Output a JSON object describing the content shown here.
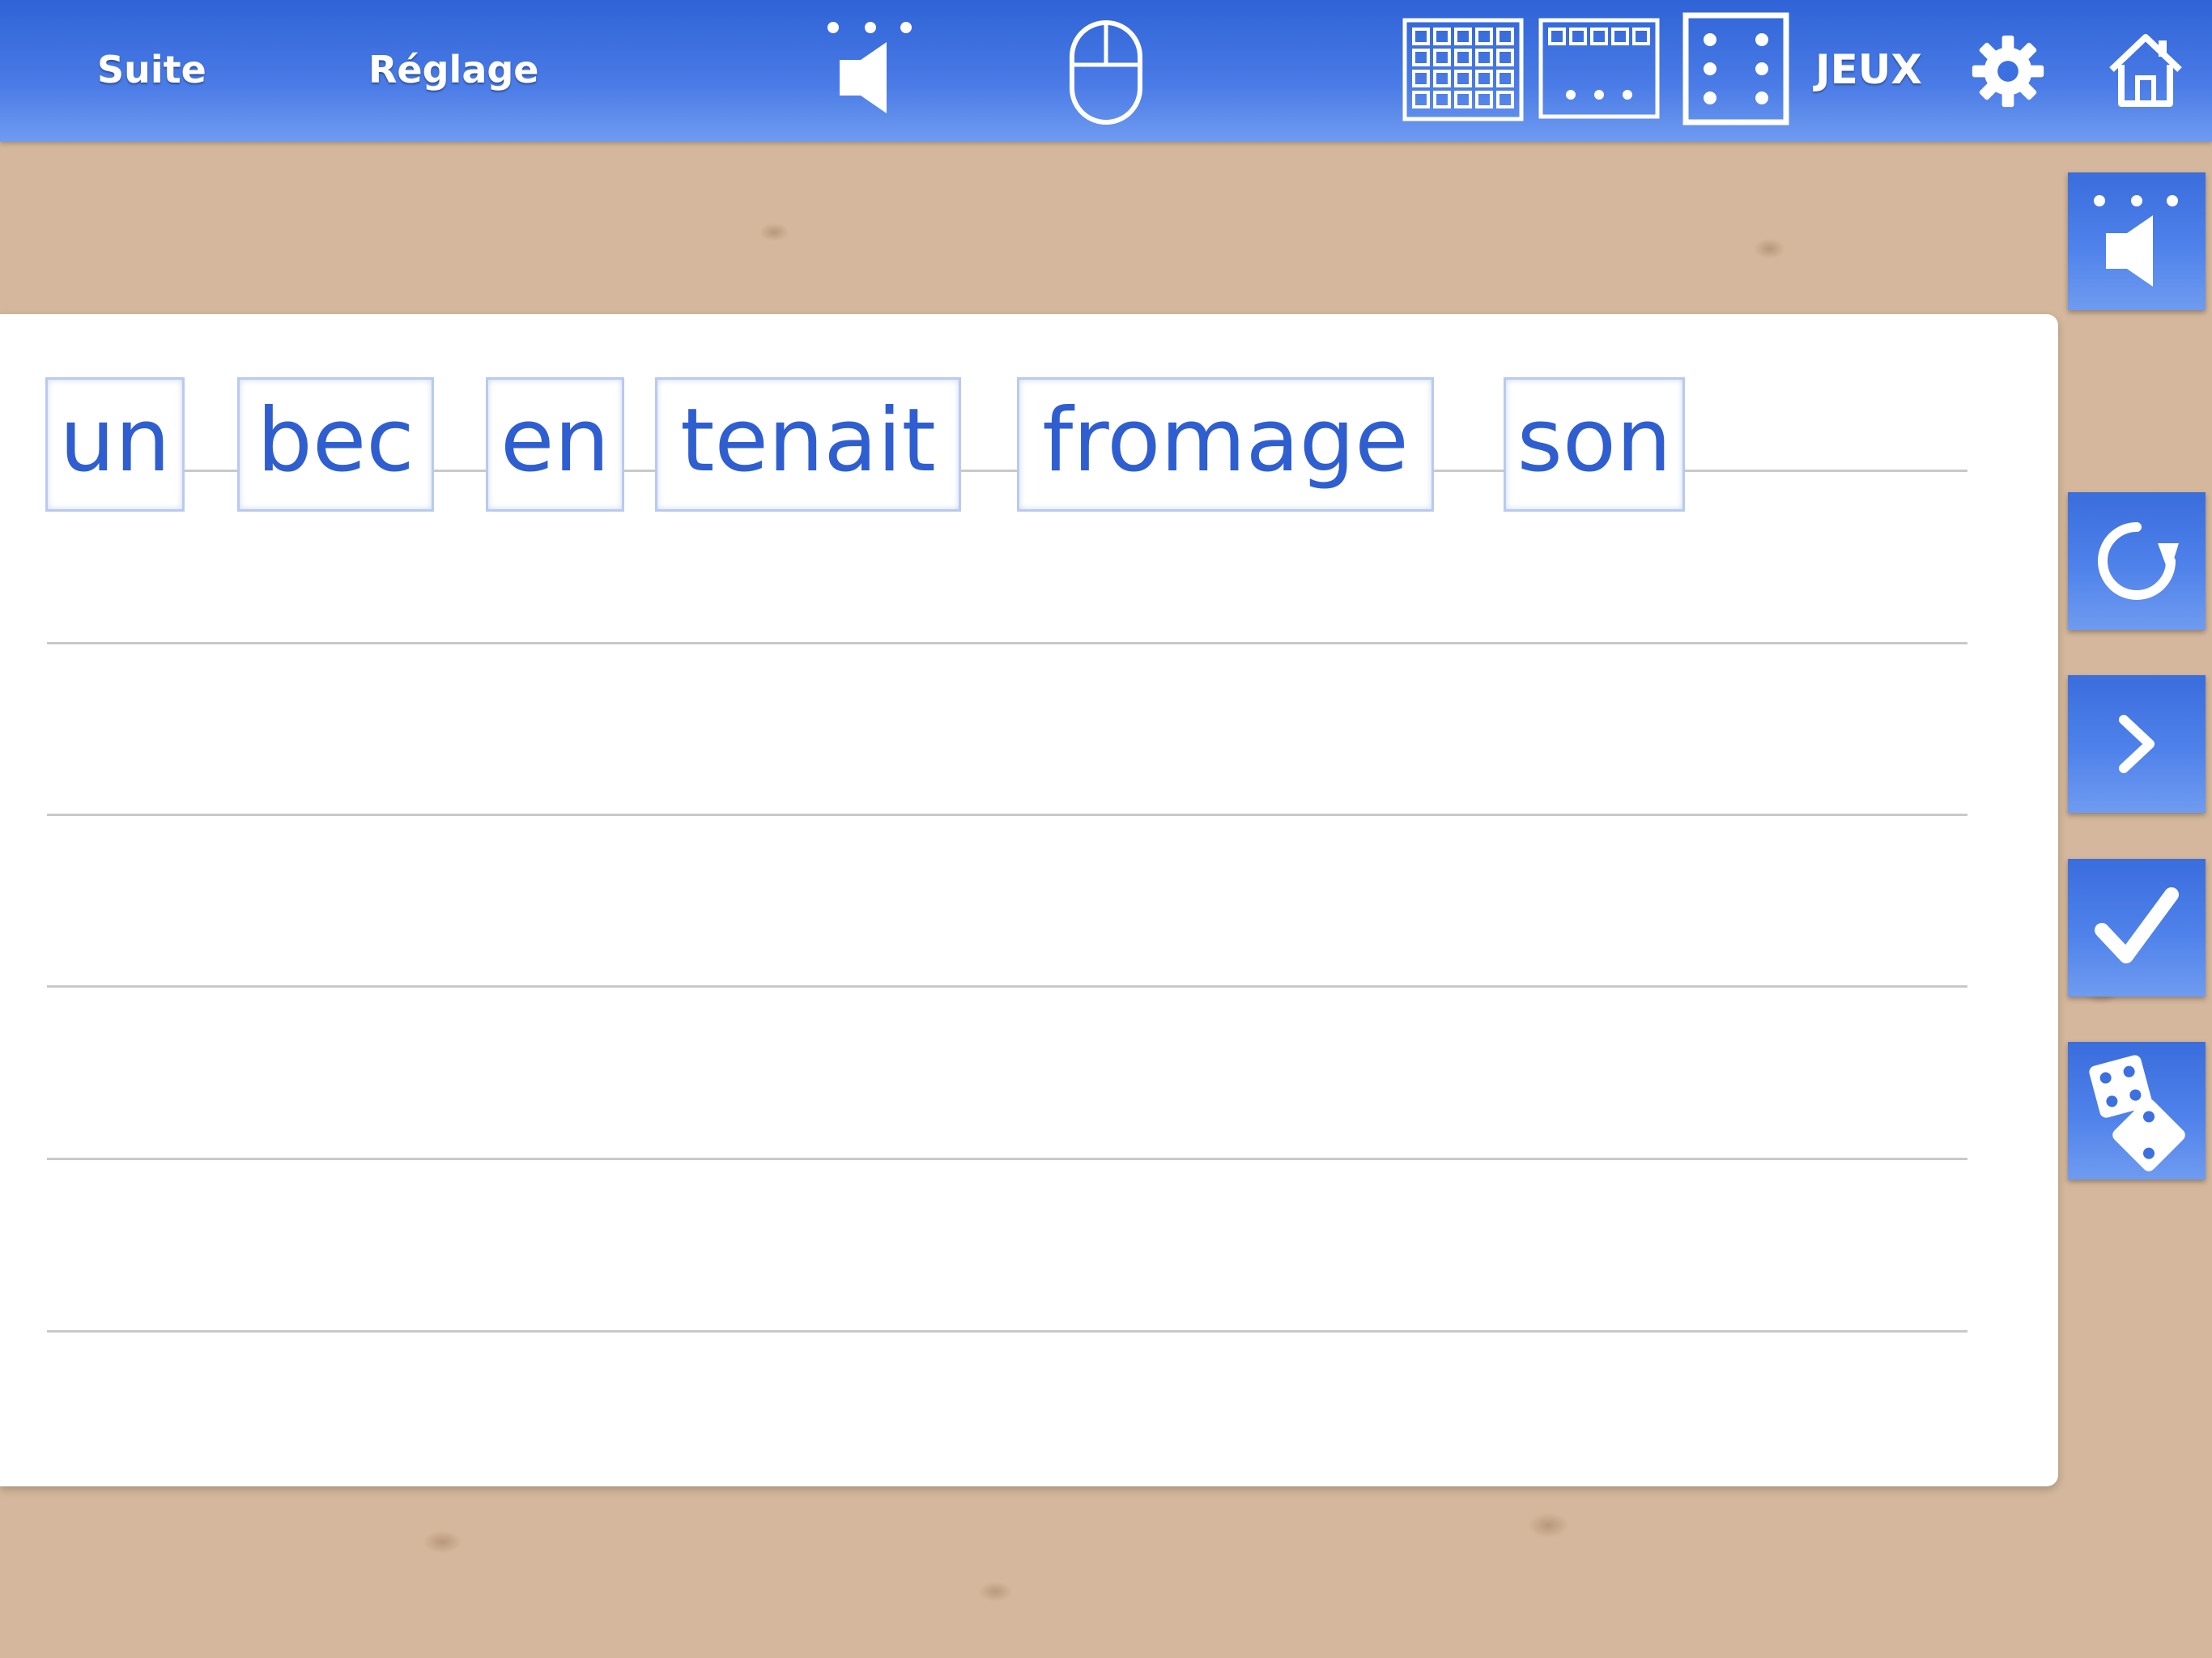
{
  "toolbar": {
    "suite_label": "Suite",
    "reglage_label": "Réglage",
    "jeux_label": "JEUX",
    "icons": [
      "speaker-dots-icon",
      "mouse-icon",
      "grid-many-icon",
      "grid-few-icon",
      "dice-six-icon",
      "gear-icon",
      "home-icon"
    ]
  },
  "words": [
    "un",
    "bec",
    "en",
    "tenait",
    "fromage",
    "son"
  ],
  "side_buttons": [
    "speaker-dots-icon",
    "reload-icon",
    "next-icon",
    "check-icon",
    "dice-icon"
  ],
  "colors": {
    "accent_blue": "#2f63d6",
    "word_text": "#2f5ed0",
    "tile_border": "#b9caf0",
    "wood": "#d9bfa6"
  }
}
